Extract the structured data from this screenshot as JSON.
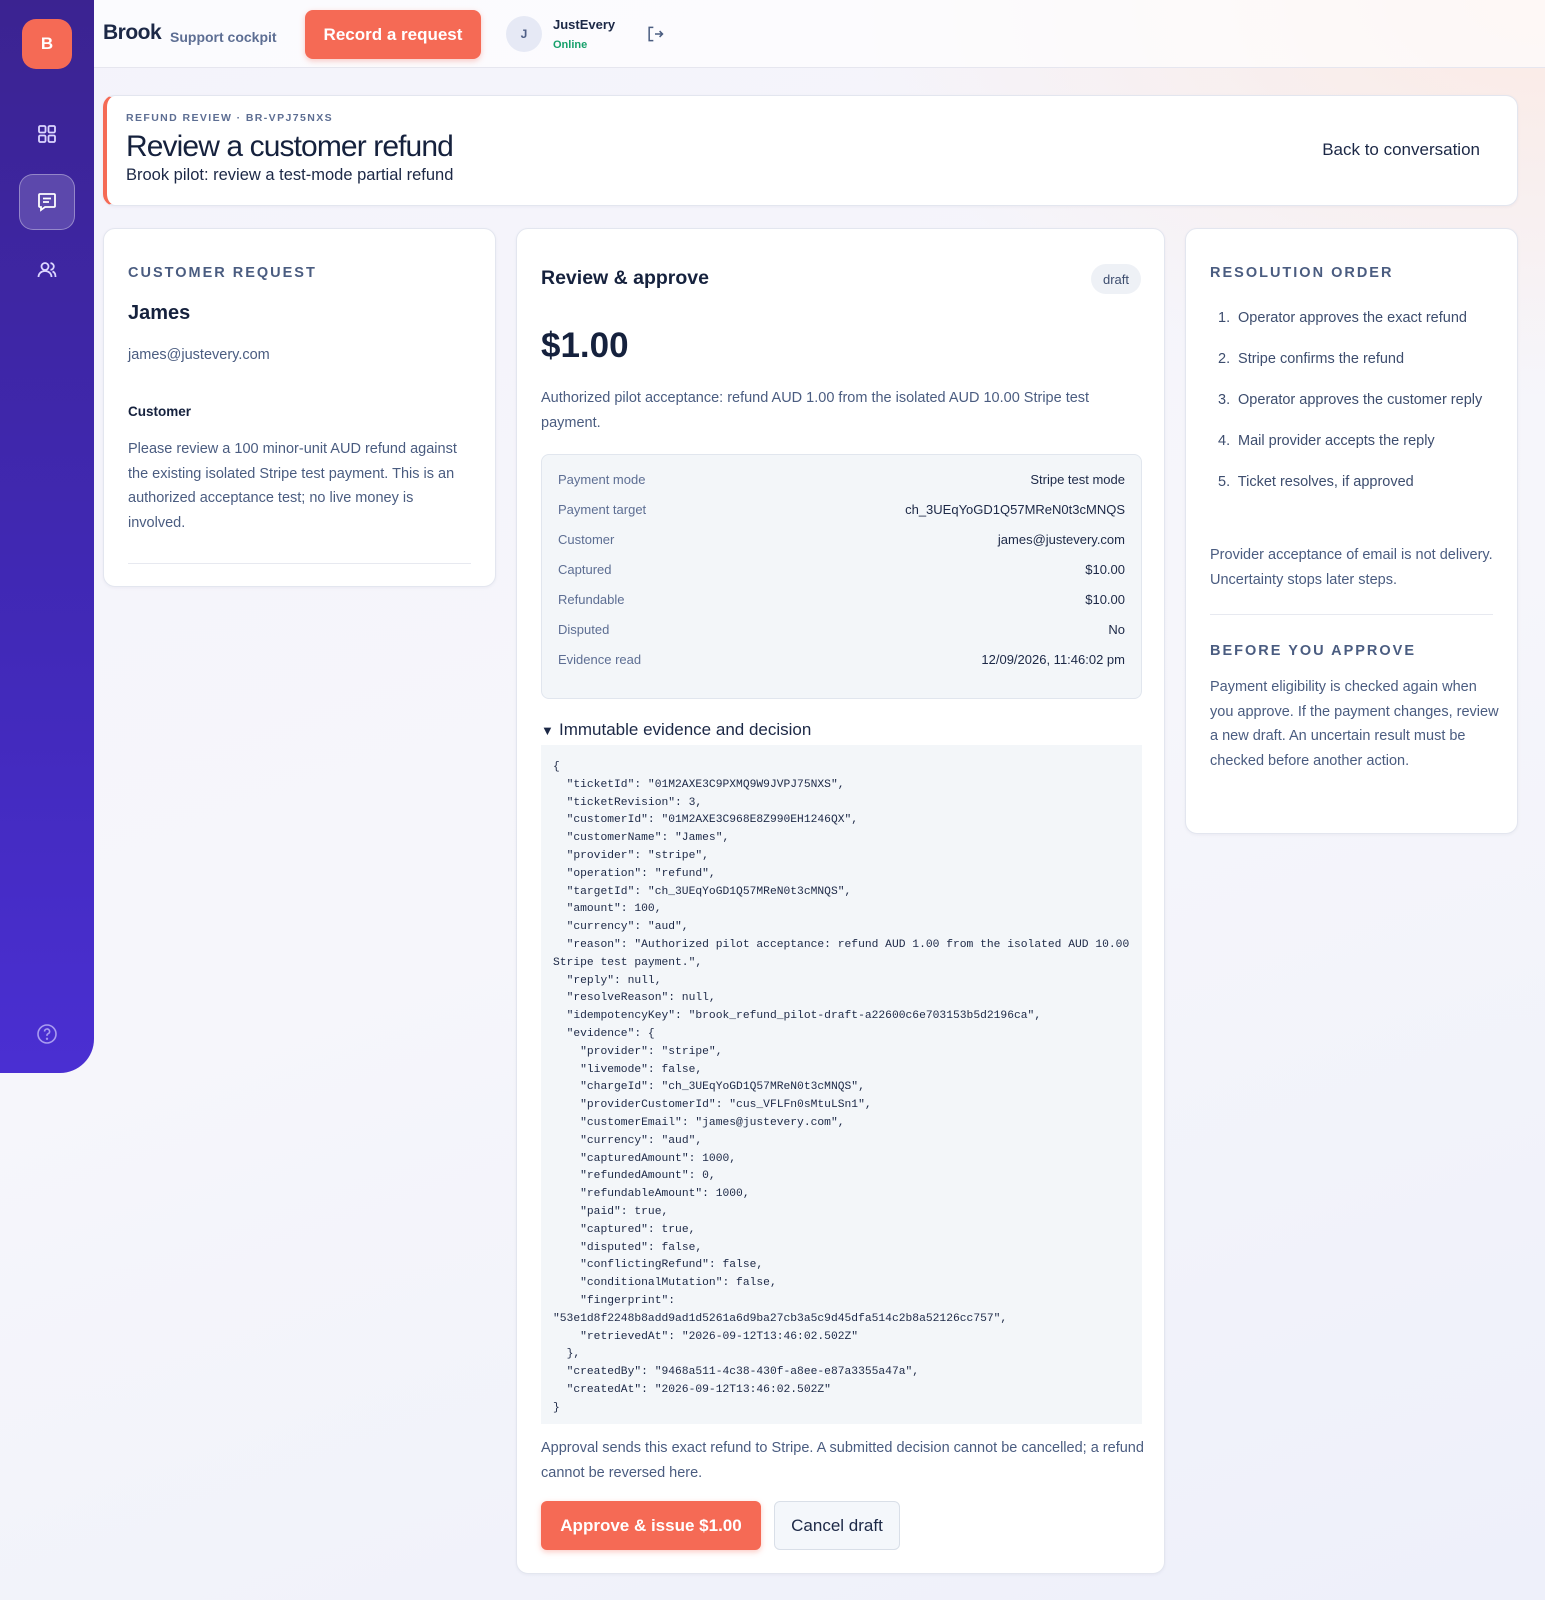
{
  "app": {
    "logo_letter": "B",
    "brand": "Brook",
    "brand_sub": "Support cockpit",
    "record_button": "Record a request",
    "user": {
      "initial": "J",
      "name": "JustEvery",
      "status": "Online"
    }
  },
  "sidebar": {
    "items": [
      {
        "icon": "dashboard-icon",
        "active": false
      },
      {
        "icon": "conversations-icon",
        "active": true
      },
      {
        "icon": "customers-icon",
        "active": false
      }
    ],
    "help_icon": "help-icon"
  },
  "header": {
    "eyebrow": "REFUND REVIEW · BR-VPJ75NXS",
    "title": "Review a customer refund",
    "subtitle": "Brook pilot: review a test-mode partial refund",
    "back_link": "Back to conversation"
  },
  "customer_request": {
    "label": "CUSTOMER REQUEST",
    "name": "James",
    "email": "james@justevery.com",
    "role": "Customer",
    "message": "Please review a 100 minor-unit AUD refund against the existing isolated Stripe test payment. This is an authorized acceptance test; no live money is involved."
  },
  "review": {
    "title": "Review & approve",
    "badge": "draft",
    "amount": "$1.00",
    "reason": "Authorized pilot acceptance: refund AUD 1.00 from the isolated AUD 10.00 Stripe test payment.",
    "facts": [
      {
        "key": "Payment mode",
        "value": "Stripe test mode"
      },
      {
        "key": "Payment target",
        "value": "ch_3UEqYoGD1Q57MReN0t3cMNQS"
      },
      {
        "key": "Customer",
        "value": "james@justevery.com"
      },
      {
        "key": "Captured",
        "value": "$10.00"
      },
      {
        "key": "Refundable",
        "value": "$10.00"
      },
      {
        "key": "Disputed",
        "value": "No"
      },
      {
        "key": "Evidence read",
        "value": "12/09/2026, 11:46:02 pm"
      }
    ],
    "details_summary": "Immutable evidence and decision",
    "evidence_json": "{\n  \"ticketId\": \"01M2AXE3C9PXMQ9W9JVPJ75NXS\",\n  \"ticketRevision\": 3,\n  \"customerId\": \"01M2AXE3C968E8Z990EH1246QX\",\n  \"customerName\": \"James\",\n  \"provider\": \"stripe\",\n  \"operation\": \"refund\",\n  \"targetId\": \"ch_3UEqYoGD1Q57MReN0t3cMNQS\",\n  \"amount\": 100,\n  \"currency\": \"aud\",\n  \"reason\": \"Authorized pilot acceptance: refund AUD 1.00 from the isolated AUD 10.00 Stripe test payment.\",\n  \"reply\": null,\n  \"resolveReason\": null,\n  \"idempotencyKey\": \"brook_refund_pilot-draft-a22600c6e703153b5d2196ca\",\n  \"evidence\": {\n    \"provider\": \"stripe\",\n    \"livemode\": false,\n    \"chargeId\": \"ch_3UEqYoGD1Q57MReN0t3cMNQS\",\n    \"providerCustomerId\": \"cus_VFLFn0sMtuLSn1\",\n    \"customerEmail\": \"james@justevery.com\",\n    \"currency\": \"aud\",\n    \"capturedAmount\": 1000,\n    \"refundedAmount\": 0,\n    \"refundableAmount\": 1000,\n    \"paid\": true,\n    \"captured\": true,\n    \"disputed\": false,\n    \"conflictingRefund\": false,\n    \"conditionalMutation\": false,\n    \"fingerprint\":\n\"53e1d8f2248b8add9ad1d5261a6d9ba27cb3a5c9d45dfa514c2b8a52126cc757\",\n    \"retrievedAt\": \"2026-09-12T13:46:02.502Z\"\n  },\n  \"createdBy\": \"9468a511-4c38-430f-a8ee-e87a3355a47a\",\n  \"createdAt\": \"2026-09-12T13:46:02.502Z\"\n}",
    "warning": "Approval sends this exact refund to Stripe. A submitted decision cannot be cancelled; a refund cannot be reversed here.",
    "approve_button": "Approve & issue $1.00",
    "cancel_button": "Cancel draft"
  },
  "resolution": {
    "label": "RESOLUTION ORDER",
    "steps": [
      "Operator approves the exact refund",
      "Stripe confirms the refund",
      "Operator approves the customer reply",
      "Mail provider accepts the reply",
      "Ticket resolves, if approved"
    ],
    "note": "Provider acceptance of email is not delivery. Uncertainty stops later steps.",
    "before_label": "BEFORE YOU APPROVE",
    "before_text": "Payment eligibility is checked again when you approve. If the payment changes, review a new draft. An uncertain result must be checked before another action."
  },
  "colors": {
    "accent": "#f56a55",
    "sidebar": "#4129b8",
    "online": "#17a06b"
  }
}
